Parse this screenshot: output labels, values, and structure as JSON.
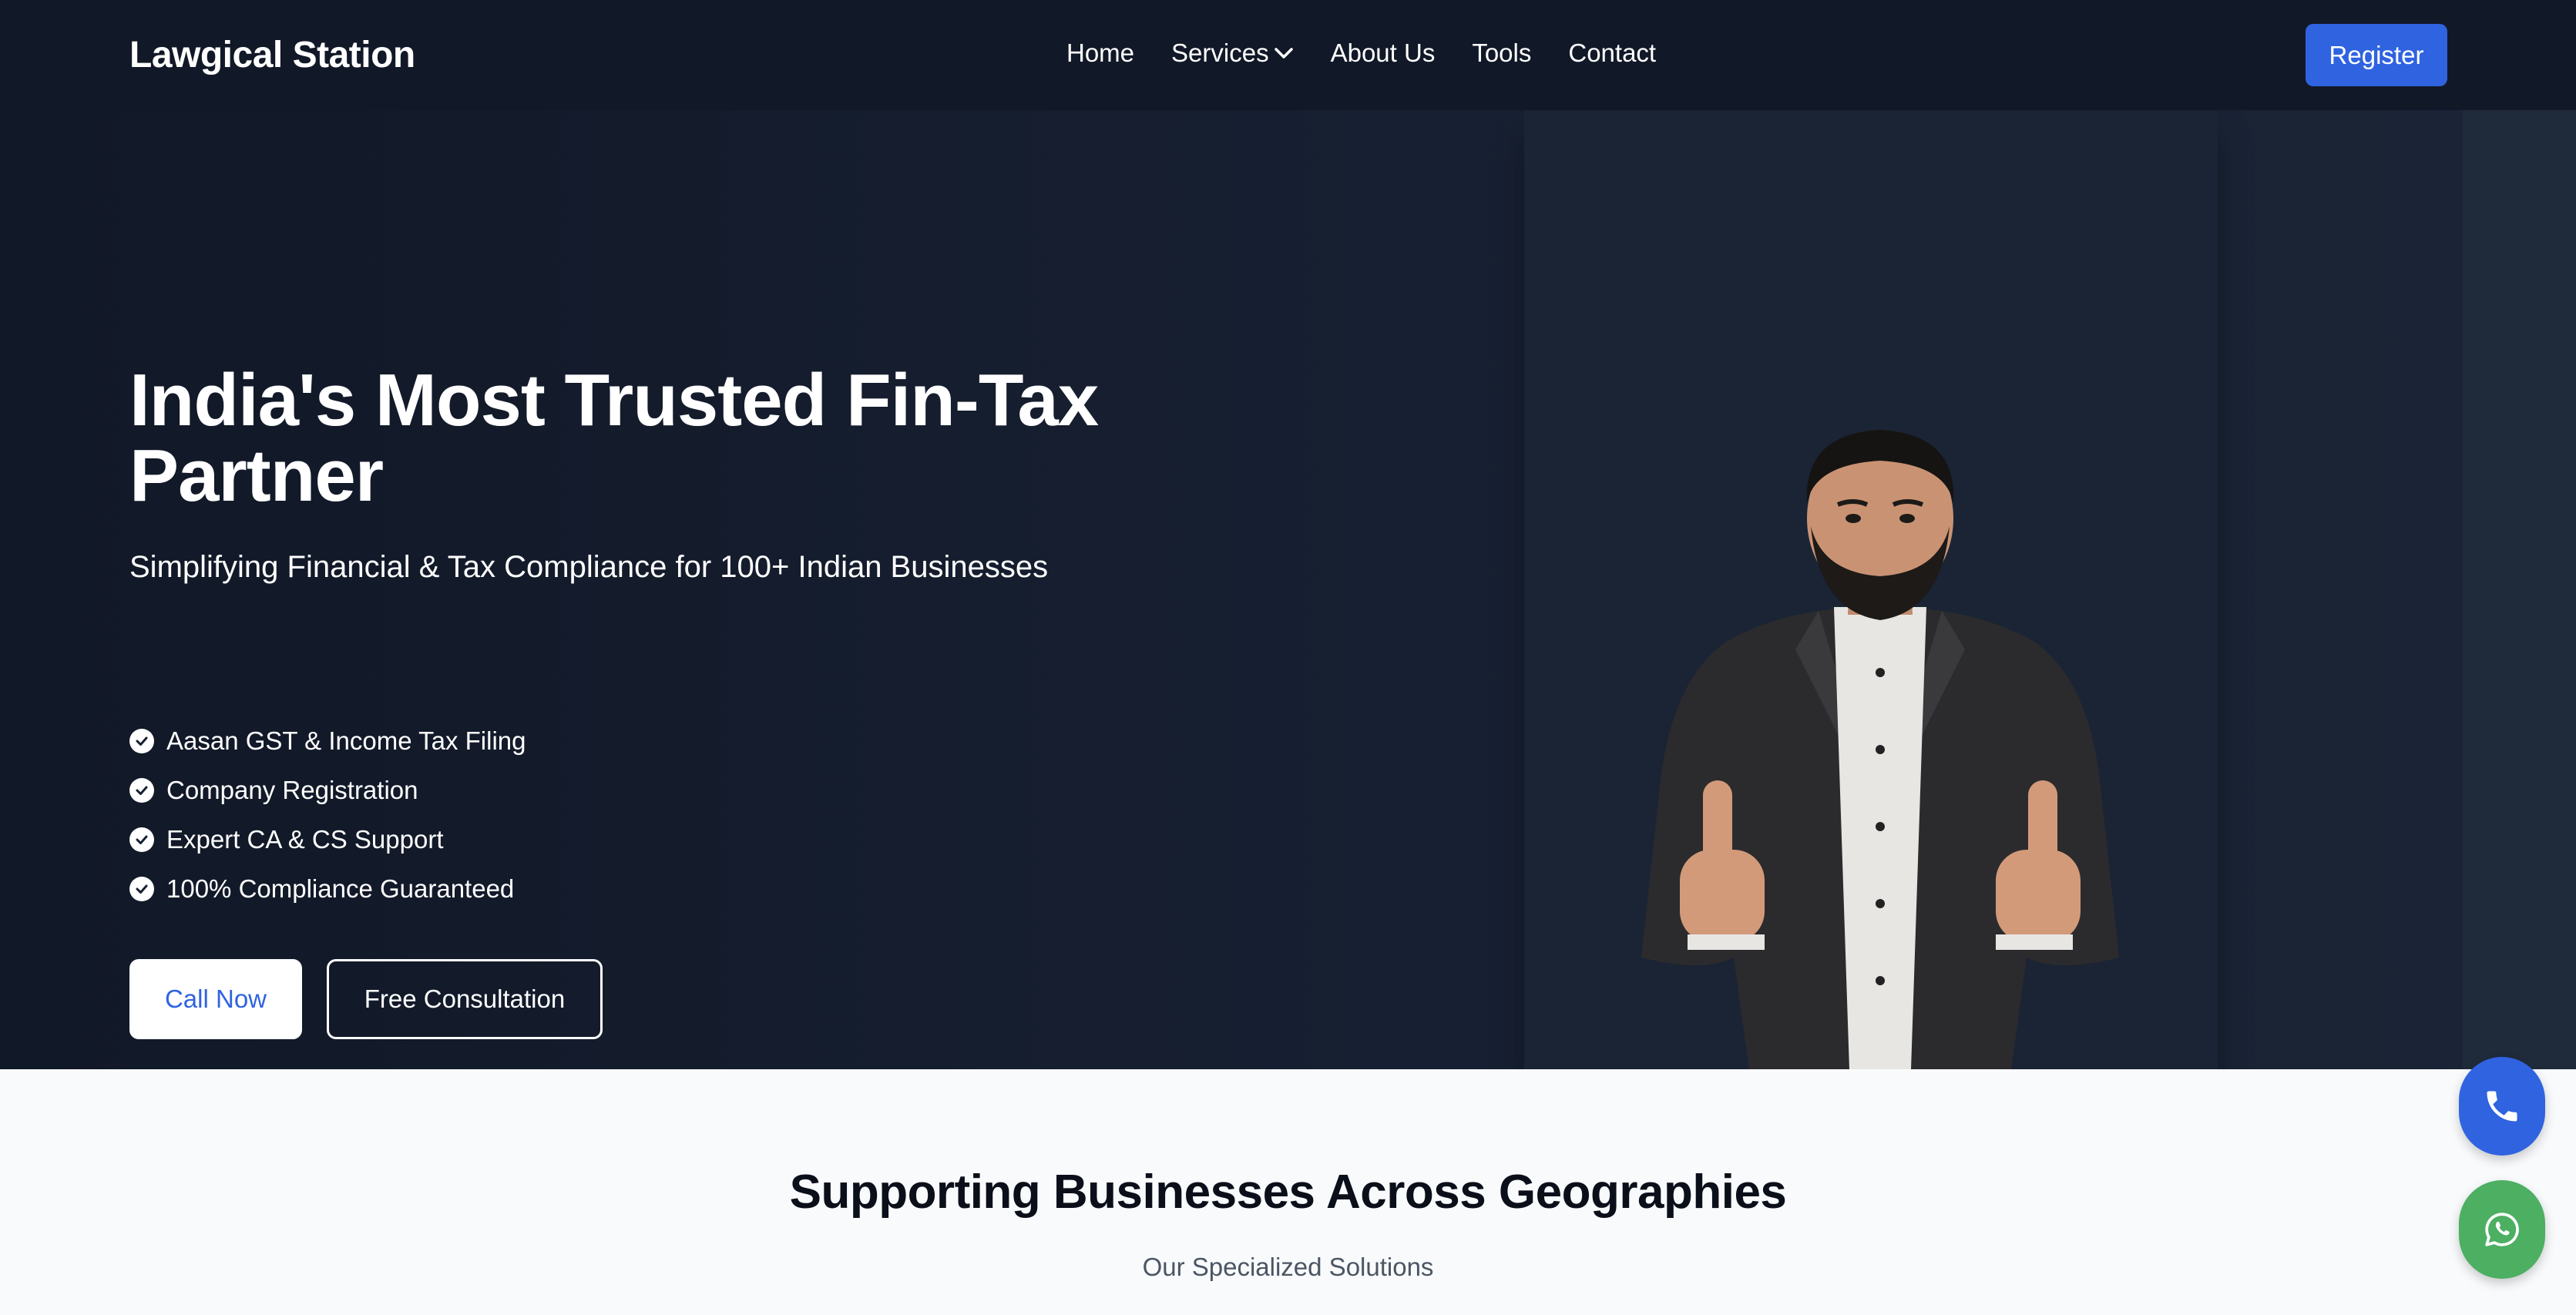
{
  "nav": {
    "brand": "Lawgical Station",
    "links": [
      {
        "label": "Home"
      },
      {
        "label": "Services"
      },
      {
        "label": "About Us"
      },
      {
        "label": "Tools"
      },
      {
        "label": "Contact"
      }
    ],
    "register_label": "Register"
  },
  "hero": {
    "title": "India's Most Trusted Fin-Tax Partner",
    "subtitle": "Simplifying Financial & Tax Compliance for 100+ Indian Businesses",
    "features": [
      "Aasan GST & Income Tax Filing",
      "Company Registration",
      "Expert CA & CS Support",
      "100% Compliance Guaranteed"
    ],
    "call_label": "Call Now",
    "consult_label": "Free Consultation"
  },
  "section": {
    "title": "Supporting Businesses Across Geographies",
    "subtitle": "Our Specialized Solutions"
  },
  "colors": {
    "nav_bg": "#111827",
    "accent": "#2f63e0",
    "whatsapp": "#4caf62"
  },
  "icons": {
    "dropdown": "chevron-down-icon",
    "feature": "check-circle-icon",
    "phone": "phone-icon",
    "whatsapp": "whatsapp-icon"
  }
}
